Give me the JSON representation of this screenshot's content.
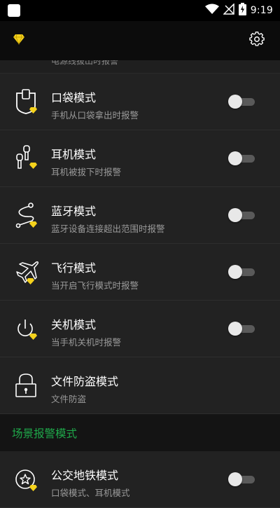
{
  "status_bar": {
    "time": "9:19"
  },
  "top_bar": {
    "left_icon": "diamond-icon",
    "right_icon": "gear-icon"
  },
  "truncated_row": {
    "sub": "电源线拔出时报警"
  },
  "rows": [
    {
      "icon": "pocket-icon",
      "title": "口袋模式",
      "sub": "手机从口袋拿出时报警",
      "toggle": false
    },
    {
      "icon": "earphone-icon",
      "title": "耳机模式",
      "sub": "耳机被拔下时报警",
      "toggle": false
    },
    {
      "icon": "bluetooth-route-icon",
      "title": "蓝牙模式",
      "sub": "蓝牙设备连接超出范围时报警",
      "toggle": false
    },
    {
      "icon": "airplane-icon",
      "title": "飞行模式",
      "sub": "当开启飞行模式时报警",
      "toggle": false
    },
    {
      "icon": "power-icon",
      "title": "关机模式",
      "sub": "当手机关机时报警",
      "toggle": false
    },
    {
      "icon": "lock-icon",
      "title": "文件防盗模式",
      "sub": "文件防盗"
    }
  ],
  "section_header": "场景报警模式",
  "scene_row": {
    "icon": "star-badge-icon",
    "title": "公交地铁模式",
    "sub": "口袋模式、耳机模式",
    "toggle": false
  },
  "colors": {
    "accent_green": "#1fa84a",
    "diamond_yellow": "#f5d21c"
  }
}
